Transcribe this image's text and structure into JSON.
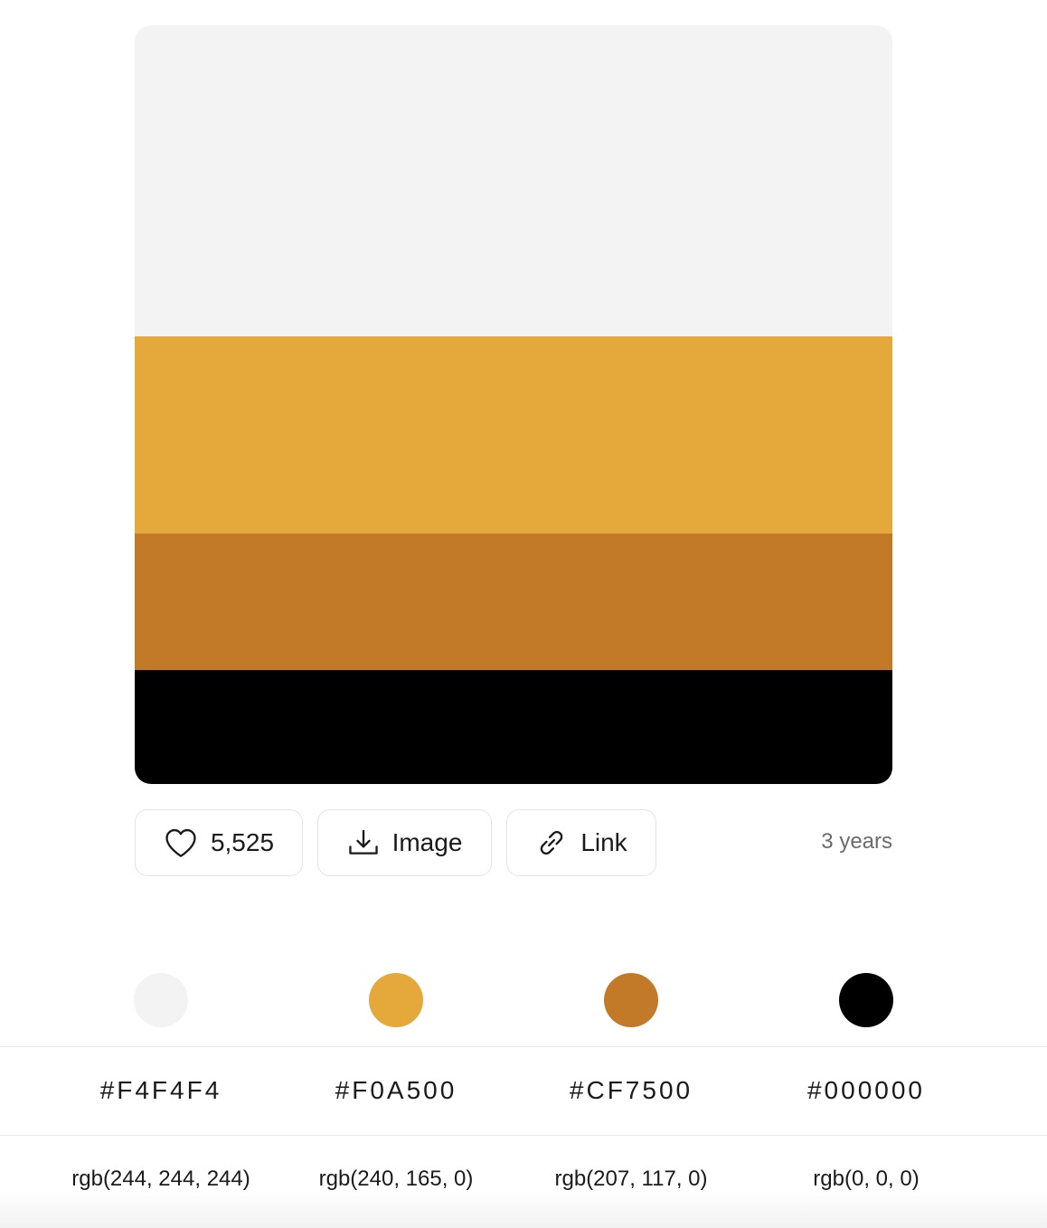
{
  "palette": {
    "colors": [
      {
        "hex": "#F4F4F4",
        "rgb": "rgb(244, 244, 244)",
        "swatch": "#F3F3F3"
      },
      {
        "hex": "#F0A500",
        "rgb": "rgb(240, 165, 0)",
        "swatch": "#E5A83B"
      },
      {
        "hex": "#CF7500",
        "rgb": "rgb(207, 117, 0)",
        "swatch": "#C27A29"
      },
      {
        "hex": "#000000",
        "rgb": "rgb(0, 0, 0)",
        "swatch": "#000000"
      }
    ]
  },
  "actions": {
    "likes": "5,525",
    "image_label": "Image",
    "link_label": "Link",
    "age": "3 years"
  },
  "icons": {
    "like": "heart-icon",
    "image": "download-icon",
    "link": "link-icon"
  }
}
